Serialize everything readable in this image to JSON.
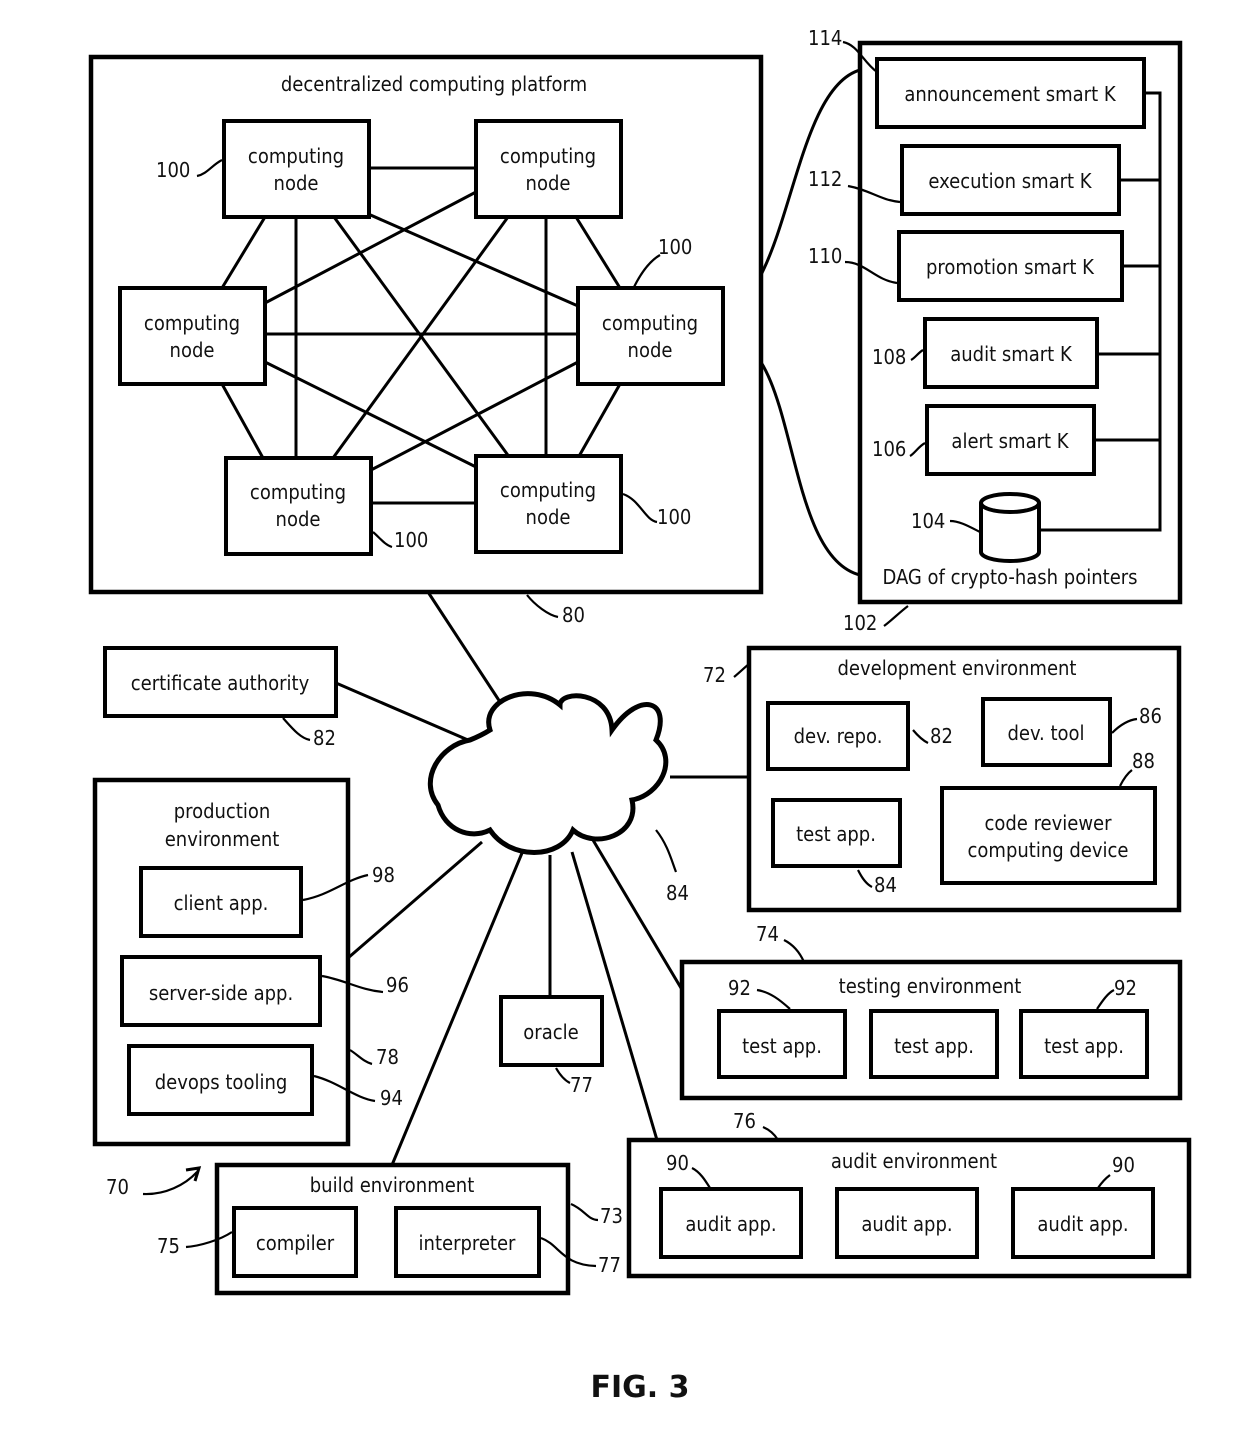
{
  "figure_label": "FIG. 3",
  "system_ref": "70",
  "network": {
    "name": "network cloud",
    "ref": "84"
  },
  "platform": {
    "title": "decentralized computing platform",
    "ref": "80",
    "node_label_line1": "computing",
    "node_label_line2": "node",
    "node_ref": "100",
    "node_count": 6
  },
  "smart_contracts": {
    "ref": "102",
    "items": [
      {
        "label": "announcement smart K",
        "ref": "114"
      },
      {
        "label": "execution smart K",
        "ref": "112"
      },
      {
        "label": "promotion smart K",
        "ref": "110"
      },
      {
        "label": "audit smart K",
        "ref": "108"
      },
      {
        "label": "alert smart K",
        "ref": "106"
      }
    ],
    "dag": {
      "label": "DAG of crypto-hash pointers",
      "ref": "104"
    }
  },
  "certificate_authority": {
    "label": "certificate authority",
    "ref": "82"
  },
  "development_environment": {
    "title": "development environment",
    "ref": "72",
    "items": [
      {
        "label": "dev. repo.",
        "ref": "82"
      },
      {
        "label": "dev. tool",
        "ref": "86"
      },
      {
        "label": "test app.",
        "ref": "84"
      },
      {
        "label_line1": "code reviewer",
        "label_line2": "computing device",
        "ref": "88"
      }
    ]
  },
  "production_environment": {
    "title_line1": "production",
    "title_line2": "environment",
    "ref": "78",
    "items": [
      {
        "label": "client app.",
        "ref": "98"
      },
      {
        "label": "server-side app.",
        "ref": "96"
      },
      {
        "label": "devops tooling",
        "ref": "94"
      }
    ]
  },
  "oracle": {
    "label": "oracle",
    "ref": "77"
  },
  "testing_environment": {
    "title": "testing environment",
    "ref": "74",
    "items": [
      {
        "label": "test app.",
        "ref": "92"
      },
      {
        "label": "test app.",
        "ref": ""
      },
      {
        "label": "test app.",
        "ref": "92"
      }
    ]
  },
  "audit_environment": {
    "title": "audit environment",
    "ref": "76",
    "items": [
      {
        "label": "audit app.",
        "ref": "90"
      },
      {
        "label": "audit app.",
        "ref": ""
      },
      {
        "label": "audit app.",
        "ref": "90"
      }
    ]
  },
  "build_environment": {
    "title": "build environment",
    "ref": "73",
    "items": [
      {
        "label": "compiler",
        "ref": "75"
      },
      {
        "label": "interpreter",
        "ref": "77"
      }
    ]
  }
}
